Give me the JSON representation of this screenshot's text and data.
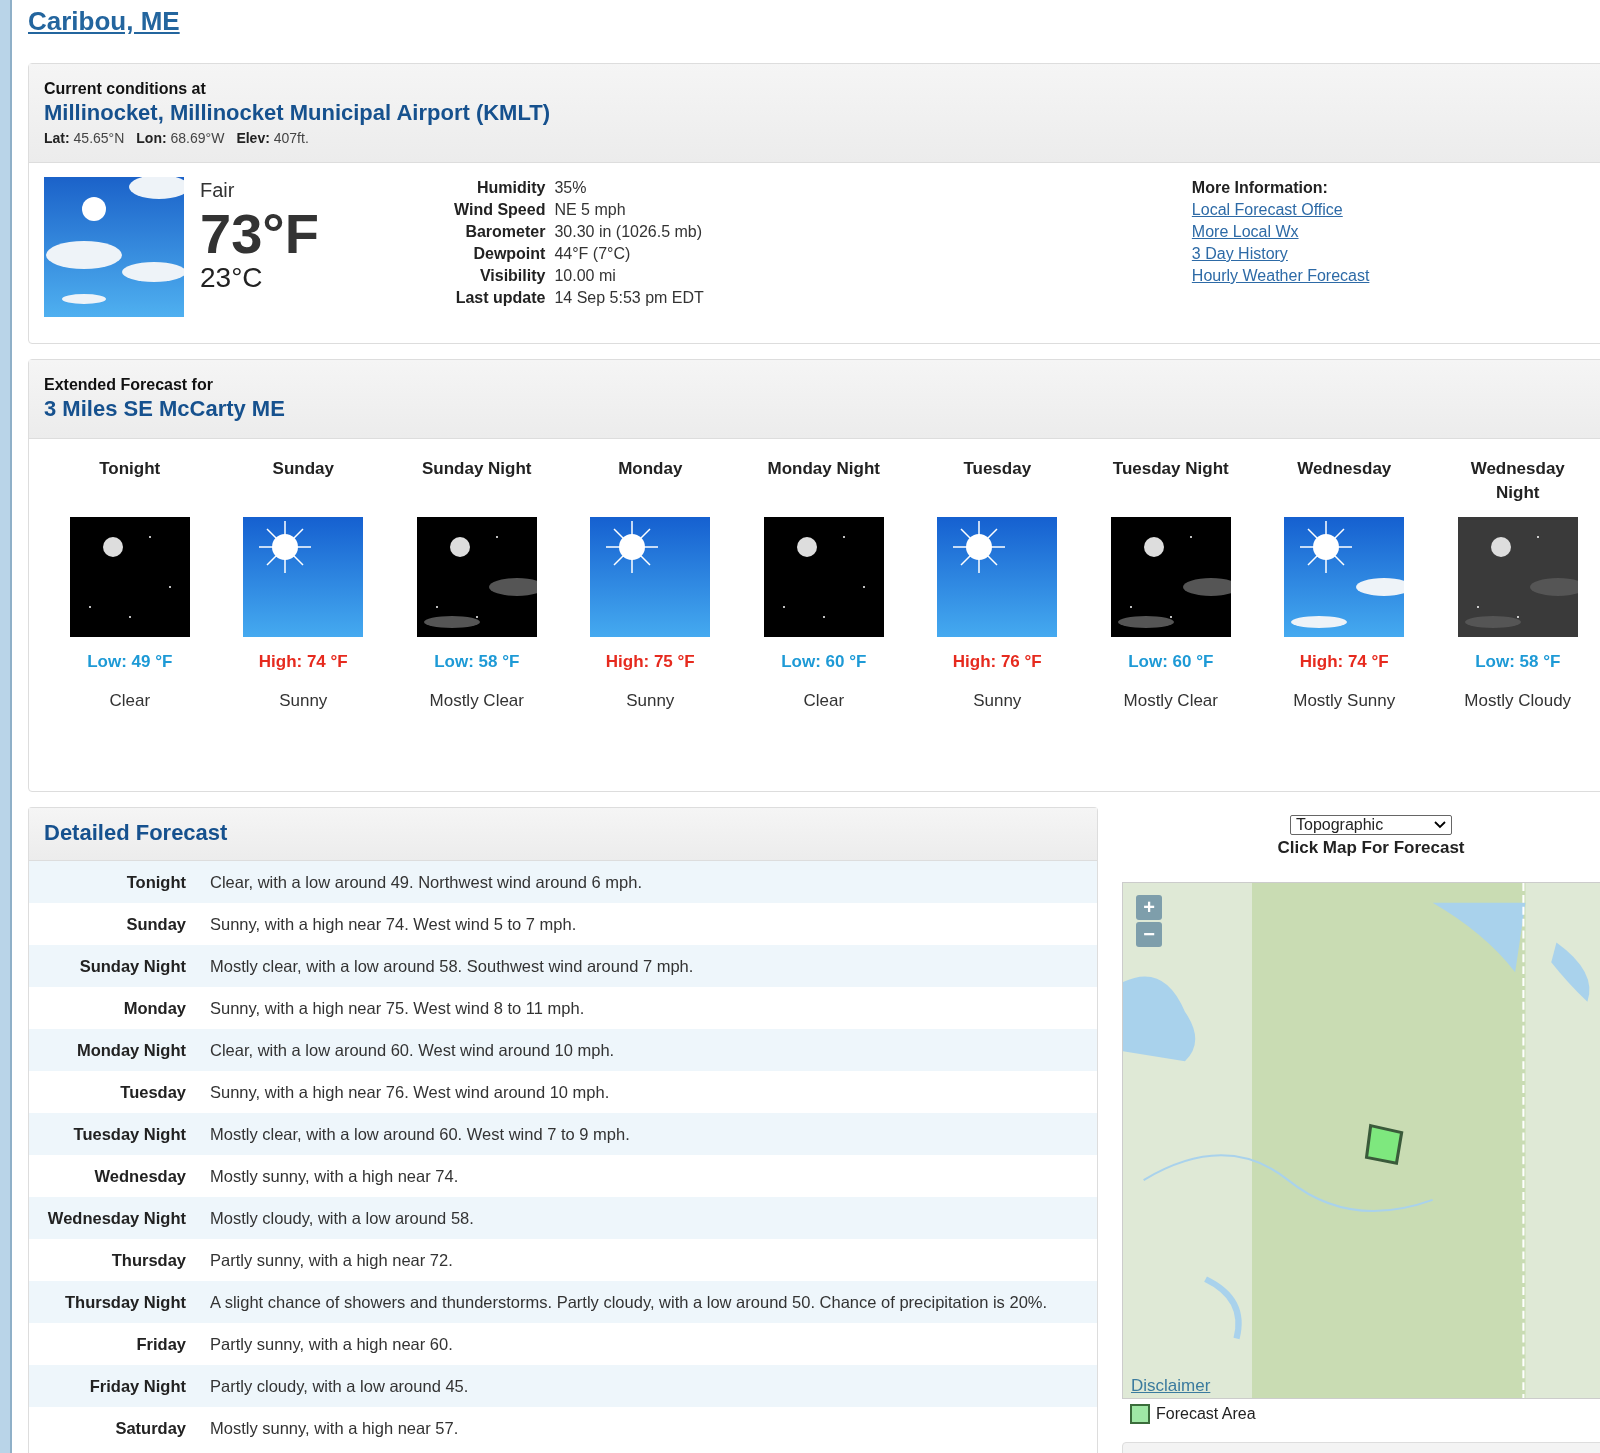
{
  "office": {
    "name": "Caribou, ME"
  },
  "current": {
    "heading": "Current conditions at",
    "station": "Millinocket, Millinocket Municipal Airport (KMLT)",
    "coords": [
      {
        "label": "Lat:",
        "value": "45.65°N"
      },
      {
        "label": "Lon:",
        "value": "68.69°W"
      },
      {
        "label": "Elev:",
        "value": "407ft."
      }
    ],
    "summary": "Fair",
    "temp_f": "73°F",
    "temp_c": "23°C",
    "details": [
      {
        "label": "Humidity",
        "value": "35%"
      },
      {
        "label": "Wind Speed",
        "value": "NE 5 mph"
      },
      {
        "label": "Barometer",
        "value": "30.30 in (1026.5 mb)"
      },
      {
        "label": "Dewpoint",
        "value": "44°F (7°C)"
      },
      {
        "label": "Visibility",
        "value": "10.00 mi"
      },
      {
        "label": "Last update",
        "value": "14 Sep 5:53 pm EDT"
      }
    ],
    "more_info": {
      "title": "More Information:",
      "links": [
        "Local Forecast Office",
        "More Local Wx",
        "3 Day History",
        "Hourly Weather Forecast"
      ]
    }
  },
  "extended": {
    "heading": "Extended Forecast for",
    "location": "3 Miles SE McCarty ME",
    "periods": [
      {
        "name": "Tonight",
        "kind": "night-clear",
        "temperature": {
          "kind": "low",
          "text": "Low: 49 °F"
        },
        "desc": "Clear"
      },
      {
        "name": "Sunday",
        "kind": "sunny",
        "temperature": {
          "kind": "high",
          "text": "High: 74 °F"
        },
        "desc": "Sunny"
      },
      {
        "name": "Sunday Night",
        "kind": "night-mostly-clear",
        "temperature": {
          "kind": "low",
          "text": "Low: 58 °F"
        },
        "desc": "Mostly Clear"
      },
      {
        "name": "Monday",
        "kind": "sunny",
        "temperature": {
          "kind": "high",
          "text": "High: 75 °F"
        },
        "desc": "Sunny"
      },
      {
        "name": "Monday Night",
        "kind": "night-clear",
        "temperature": {
          "kind": "low",
          "text": "Low: 60 °F"
        },
        "desc": "Clear"
      },
      {
        "name": "Tuesday",
        "kind": "sunny",
        "temperature": {
          "kind": "high",
          "text": "High: 76 °F"
        },
        "desc": "Sunny"
      },
      {
        "name": "Tuesday Night",
        "kind": "night-mostly-clear",
        "temperature": {
          "kind": "low",
          "text": "Low: 60 °F"
        },
        "desc": "Mostly Clear"
      },
      {
        "name": "Wednesday",
        "kind": "mostly-sunny",
        "temperature": {
          "kind": "high",
          "text": "High: 74 °F"
        },
        "desc": "Mostly Sunny"
      },
      {
        "name": "Wednesday Night",
        "kind": "night-mostly-cloudy",
        "temperature": {
          "kind": "low",
          "text": "Low: 58 °F"
        },
        "desc": "Mostly Cloudy"
      }
    ]
  },
  "detailed": {
    "title": "Detailed Forecast",
    "rows": [
      {
        "period": "Tonight",
        "text": "Clear, with a low around 49. Northwest wind around 6 mph."
      },
      {
        "period": "Sunday",
        "text": "Sunny, with a high near 74. West wind 5 to 7 mph."
      },
      {
        "period": "Sunday Night",
        "text": "Mostly clear, with a low around 58. Southwest wind around 7 mph."
      },
      {
        "period": "Monday",
        "text": "Sunny, with a high near 75. West wind 8 to 11 mph."
      },
      {
        "period": "Monday Night",
        "text": "Clear, with a low around 60. West wind around 10 mph."
      },
      {
        "period": "Tuesday",
        "text": "Sunny, with a high near 76. West wind around 10 mph."
      },
      {
        "period": "Tuesday Night",
        "text": "Mostly clear, with a low around 60. West wind 7 to 9 mph."
      },
      {
        "period": "Wednesday",
        "text": "Mostly sunny, with a high near 74."
      },
      {
        "period": "Wednesday Night",
        "text": "Mostly cloudy, with a low around 58."
      },
      {
        "period": "Thursday",
        "text": "Partly sunny, with a high near 72."
      },
      {
        "period": "Thursday Night",
        "text": "A slight chance of showers and thunderstorms. Partly cloudy, with a low around 50. Chance of precipitation is 20%."
      },
      {
        "period": "Friday",
        "text": "Partly sunny, with a high near 60."
      },
      {
        "period": "Friday Night",
        "text": "Partly cloudy, with a low around 45."
      },
      {
        "period": "Saturday",
        "text": "Mostly sunny, with a high near 57."
      }
    ]
  },
  "map": {
    "layer": "Topographic",
    "caption": "Click Map For Forecast",
    "zoom_in": "+",
    "zoom_out": "−",
    "disclaimer": "Disclaimer",
    "legend": "Forecast Area"
  }
}
